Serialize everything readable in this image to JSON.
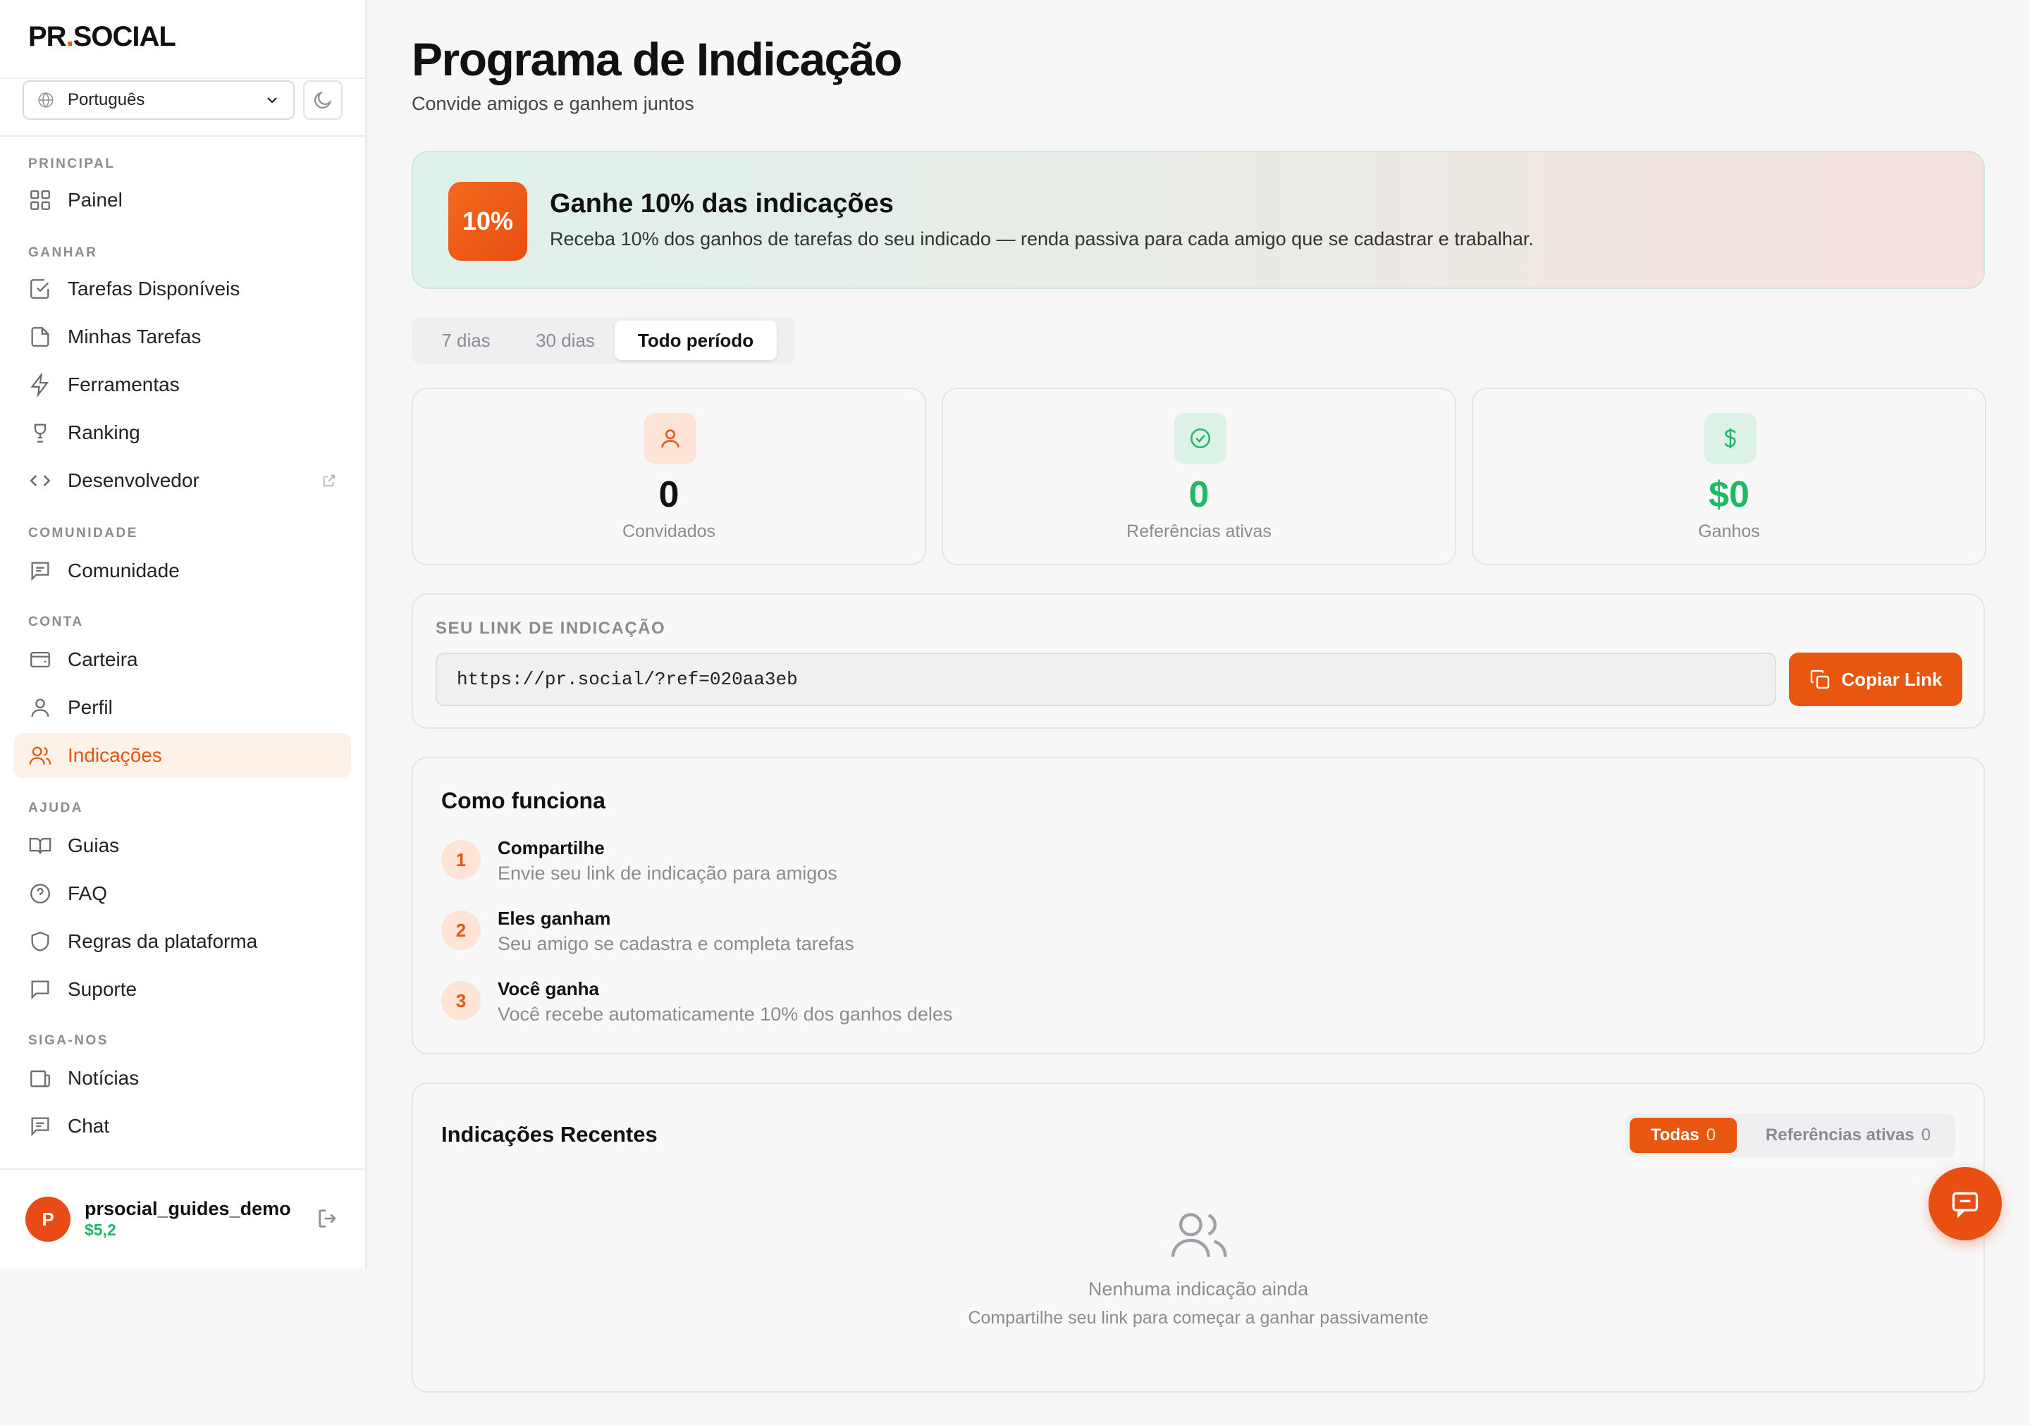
{
  "app": {
    "logo_prefix": "PR",
    "logo_dot": ".",
    "logo_suffix": "SOCIAL"
  },
  "sidebar": {
    "language": "Português",
    "sections": {
      "principal": "PRINCIPAL",
      "ganhar": "GANHAR",
      "comunidade": "COMUNIDADE",
      "conta": "CONTA",
      "ajuda": "AJUDA",
      "siga": "SIGA-NOS"
    },
    "items": {
      "painel": "Painel",
      "tarefas_disponiveis": "Tarefas Disponíveis",
      "minhas_tarefas": "Minhas Tarefas",
      "ferramentas": "Ferramentas",
      "ranking": "Ranking",
      "desenvolvedor": "Desenvolvedor",
      "comunidade": "Comunidade",
      "carteira": "Carteira",
      "perfil": "Perfil",
      "indicacoes": "Indicações",
      "guias": "Guias",
      "faq": "FAQ",
      "regras": "Regras da plataforma",
      "suporte": "Suporte",
      "noticias": "Notícias",
      "chat": "Chat"
    },
    "user": {
      "initial": "P",
      "name": "prsocial_guides_demo",
      "balance": "$5,2"
    }
  },
  "page": {
    "title": "Programa de Indicação",
    "subtitle": "Convide amigos e ganhem juntos"
  },
  "banner": {
    "badge": "10%",
    "heading": "Ganhe 10% das indicações",
    "text": "Receba 10% dos ganhos de tarefas do seu indicado — renda passiva para cada amigo que se cadastrar e trabalhar."
  },
  "period_tabs": {
    "t7": "7 dias",
    "t30": "30 dias",
    "all": "Todo período",
    "selected": "Todo período"
  },
  "stats": {
    "invited": {
      "value": "0",
      "label": "Convidados"
    },
    "active": {
      "value": "0",
      "label": "Referências ativas"
    },
    "earnings": {
      "value": "$0",
      "label": "Ganhos"
    }
  },
  "referral_link": {
    "heading": "SEU LINK DE INDICAÇÃO",
    "url": "https://pr.social/?ref=020aa3eb",
    "copy_label": "Copiar Link"
  },
  "how": {
    "heading": "Como funciona",
    "steps": [
      {
        "num": "1",
        "title": "Compartilhe",
        "desc": "Envie seu link de indicação para amigos"
      },
      {
        "num": "2",
        "title": "Eles ganham",
        "desc": "Seu amigo se cadastra e completa tarefas"
      },
      {
        "num": "3",
        "title": "Você ganha",
        "desc": "Você recebe automaticamente 10% dos ganhos deles"
      }
    ]
  },
  "recent": {
    "heading": "Indicações Recentes",
    "filter_all": "Todas",
    "filter_all_count": "0",
    "filter_active": "Referências ativas",
    "filter_active_count": "0",
    "empty_title": "Nenhuma indicação ainda",
    "empty_sub": "Compartilhe seu link para começar a ganhar passivamente"
  },
  "colors": {
    "accent": "#e8560f",
    "green": "#1fb866",
    "muted": "#8b8b92"
  }
}
